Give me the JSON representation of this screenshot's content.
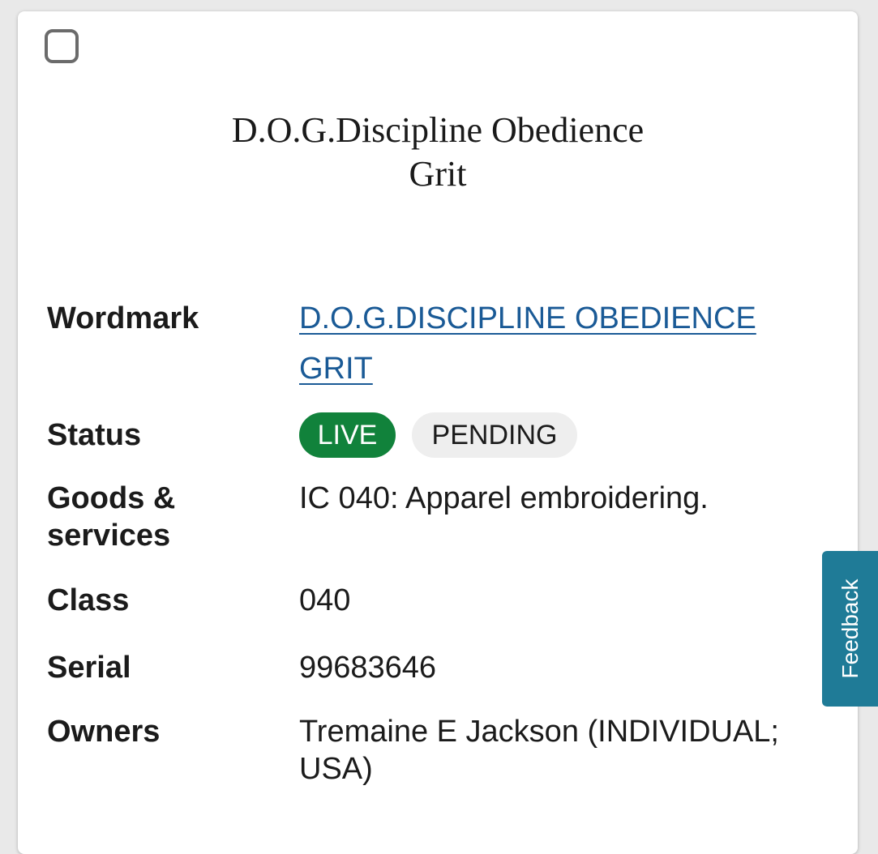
{
  "mark": {
    "image_text_line1": "D.O.G.Discipline Obedience",
    "image_text_line2": "Grit"
  },
  "fields": {
    "wordmark": {
      "label": "Wordmark",
      "line1": "D.O.G.DISCIPLINE OBEDIENCE",
      "line2": "GRIT"
    },
    "status": {
      "label": "Status",
      "badge_live": "LIVE",
      "badge_pending": "PENDING",
      "live_color": "#11823b"
    },
    "goods": {
      "label_line1": "Goods &",
      "label_line2": "services",
      "value": "IC 040: Apparel embroidering."
    },
    "class": {
      "label": "Class",
      "value": "040"
    },
    "serial": {
      "label": "Serial",
      "value": "99683646"
    },
    "owners": {
      "label": "Owners",
      "value_line1": "Tremaine E Jackson (INDIVIDUAL;",
      "value_line2": "USA)"
    }
  },
  "feedback": {
    "label": "Feedback",
    "color": "#1f7b97"
  },
  "select_checkbox": {
    "icon": "checkbox-unchecked-icon",
    "checked": false
  }
}
